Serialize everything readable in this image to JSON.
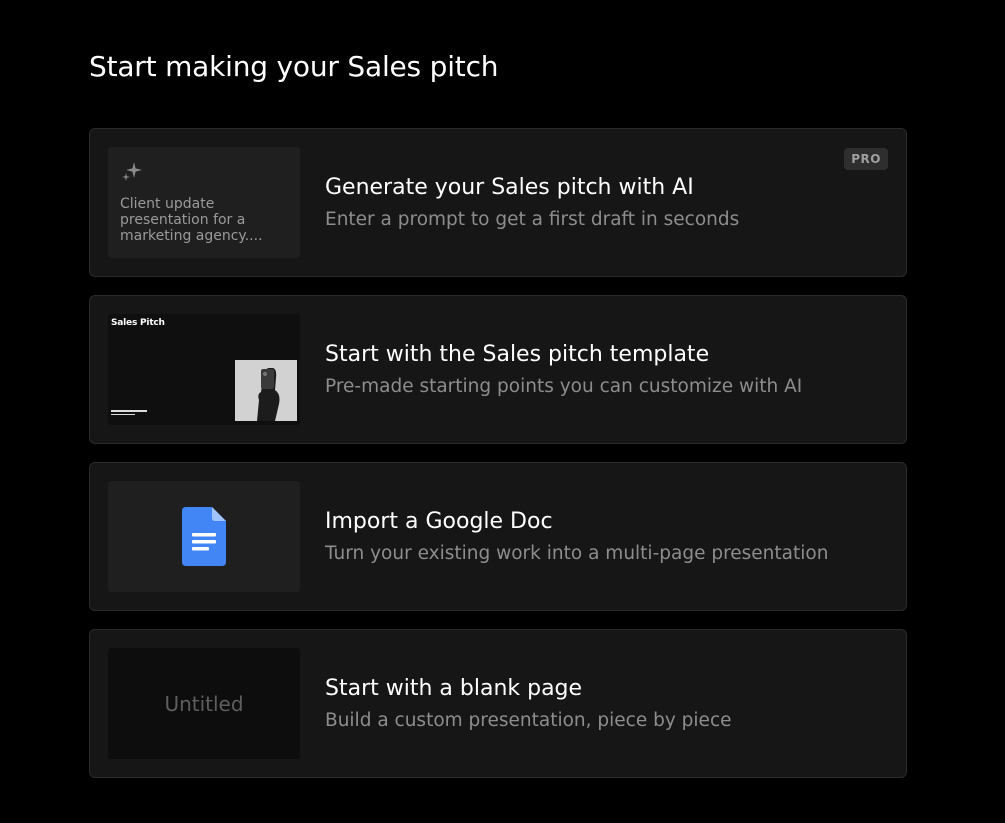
{
  "page": {
    "title": "Start making your Sales pitch"
  },
  "options": [
    {
      "title": "Generate your Sales pitch with AI",
      "subtitle": "Enter a prompt to get a first draft in seconds",
      "badge": "PRO",
      "thumb_icon": "sparkle-icon",
      "thumb_text": "Client update presentation for a marketing agency...."
    },
    {
      "title": "Start with the Sales pitch template",
      "subtitle": "Pre-made starting points you can customize with AI",
      "thumb_title": "Sales Pitch"
    },
    {
      "title": "Import a Google Doc",
      "subtitle": "Turn your existing work into a multi-page presentation",
      "thumb_icon": "google-doc-icon"
    },
    {
      "title": "Start with a blank page",
      "subtitle": "Build a custom presentation, piece by piece",
      "thumb_text": "Untitled"
    }
  ],
  "colors": {
    "background": "#000000",
    "card": "#161616",
    "google_doc_blue": "#4285f4"
  }
}
